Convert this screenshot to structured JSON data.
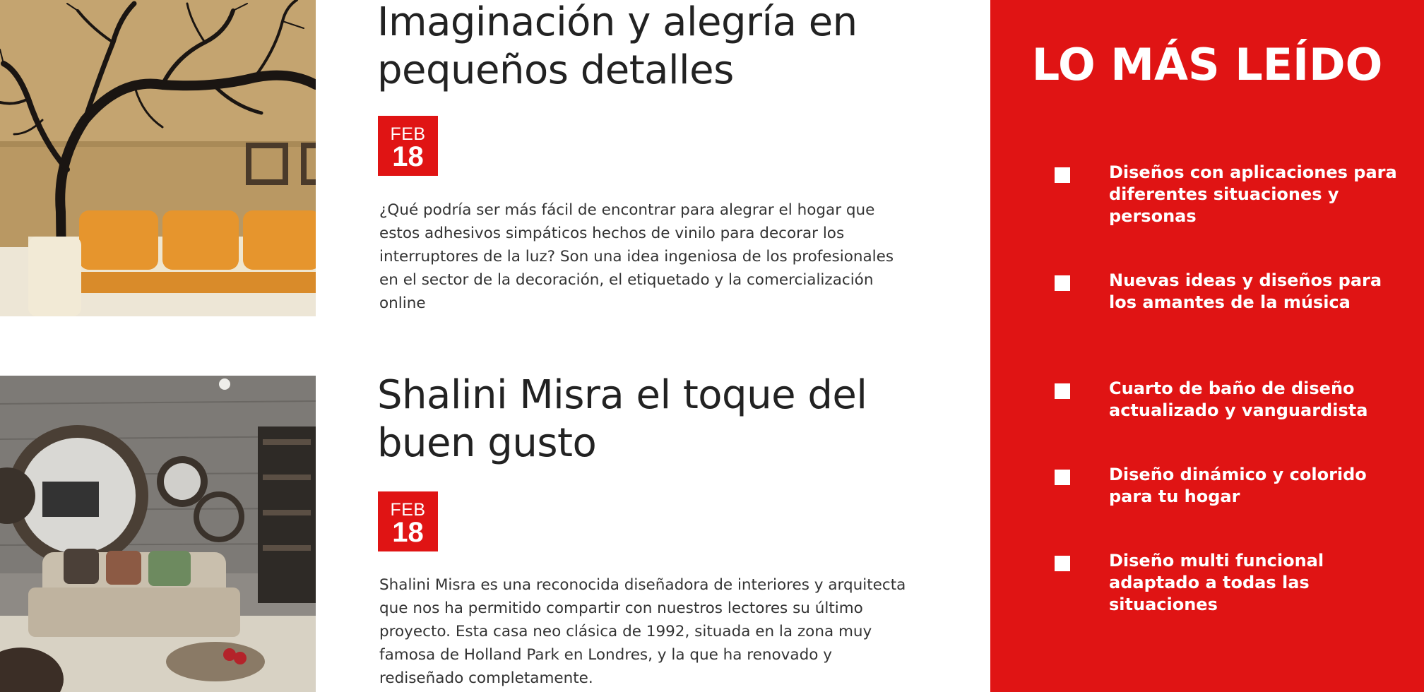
{
  "articles": [
    {
      "title": "Imaginación y alegría en pequeños detalles",
      "date": {
        "month": "FEB",
        "day": "18"
      },
      "excerpt": "¿Qué podría ser más fácil de encontrar para alegrar el hogar que estos adhesivos simpáticos hechos de vinilo para decorar los interruptores de la luz? Son una idea ingeniosa de los profesionales en el sector de la decoración, el etiquetado y la comercialización online"
    },
    {
      "title": "Shalini Misra el toque del buen gusto",
      "date": {
        "month": "FEB",
        "day": "18"
      },
      "excerpt": "Shalini Misra es una reconocida diseñadora de interiores y arquitecta que nos ha permitido compartir con nuestros lectores su último proyecto. Esta casa neo clásica de 1992, situada en la zona muy famosa de Holland Park en Londres, y la que ha renovado y rediseñado completamente."
    }
  ],
  "sidebar": {
    "title": "LO MÁS LEÍDO",
    "items": [
      "Diseños con aplicaciones para diferentes situaciones y personas",
      "Nuevas ideas y diseños para los amantes de la música",
      "Cuarto de baño de diseño actualizado y vanguardista",
      "Diseño dinámico y colorido para tu hogar",
      "Diseño multi funcional adaptado a todas las situaciones"
    ]
  },
  "colors": {
    "accent": "#e01414",
    "text": "#222222",
    "background": "#ffffff"
  }
}
